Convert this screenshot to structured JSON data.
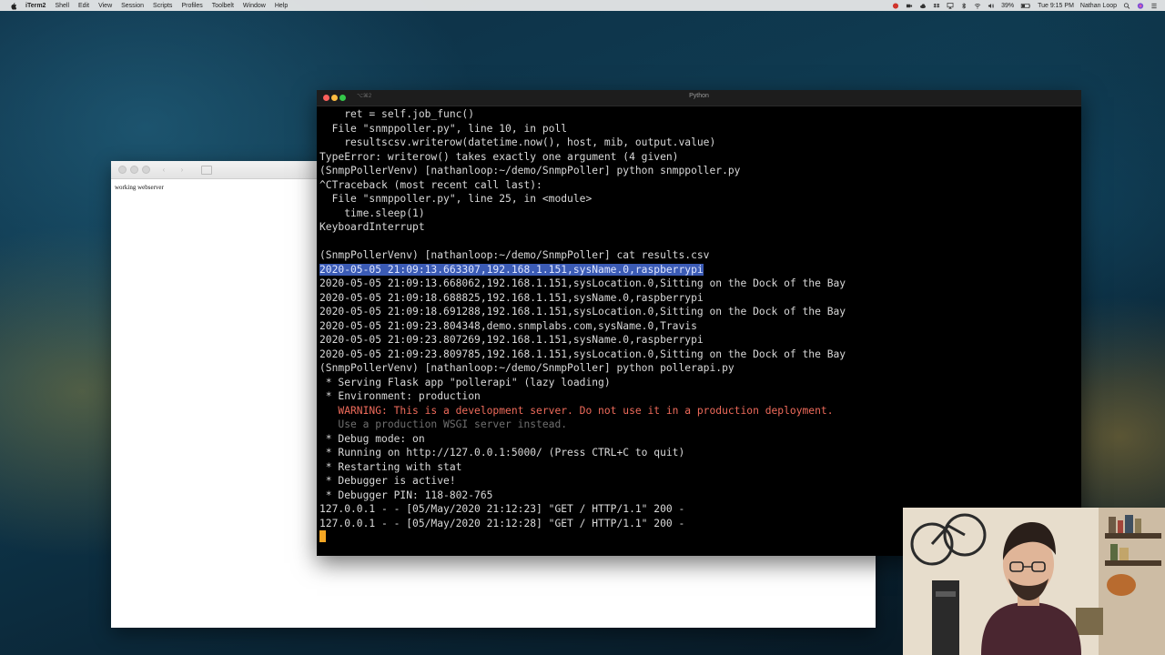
{
  "menubar": {
    "app_name": "iTerm2",
    "items": [
      "Shell",
      "Edit",
      "View",
      "Session",
      "Scripts",
      "Profiles",
      "Toolbelt",
      "Window",
      "Help"
    ],
    "battery": "39%",
    "clock": "Tue 9:15 PM",
    "user": "Nathan Loop"
  },
  "browser": {
    "content_text": "working webserver"
  },
  "terminal": {
    "shortcut": "⌥⌘2",
    "title": "Python",
    "lines": [
      "    ret = self.job_func()",
      "  File \"snmppoller.py\", line 10, in poll",
      "    resultscsv.writerow(datetime.now(), host, mib, output.value)",
      "TypeError: writerow() takes exactly one argument (4 given)",
      "(SnmpPollerVenv) [nathanloop:~/demo/SnmpPoller] python snmppoller.py",
      "^CTraceback (most recent call last):",
      "  File \"snmppoller.py\", line 25, in <module>",
      "    time.sleep(1)",
      "KeyboardInterrupt",
      "",
      "(SnmpPollerVenv) [nathanloop:~/demo/SnmpPoller] cat results.csv",
      "2020-05-05 21:09:13.663307,192.168.1.151,sysName.0,raspberrypi",
      "2020-05-05 21:09:13.668062,192.168.1.151,sysLocation.0,Sitting on the Dock of the Bay",
      "2020-05-05 21:09:18.688825,192.168.1.151,sysName.0,raspberrypi",
      "2020-05-05 21:09:18.691288,192.168.1.151,sysLocation.0,Sitting on the Dock of the Bay",
      "2020-05-05 21:09:23.804348,demo.snmplabs.com,sysName.0,Travis",
      "2020-05-05 21:09:23.807269,192.168.1.151,sysName.0,raspberrypi",
      "2020-05-05 21:09:23.809785,192.168.1.151,sysLocation.0,Sitting on the Dock of the Bay",
      "(SnmpPollerVenv) [nathanloop:~/demo/SnmpPoller] python pollerapi.py",
      " * Serving Flask app \"pollerapi\" (lazy loading)",
      " * Environment: production",
      "   WARNING: This is a development server. Do not use it in a production deployment.",
      "   Use a production WSGI server instead.",
      " * Debug mode: on",
      " * Running on http://127.0.0.1:5000/ (Press CTRL+C to quit)",
      " * Restarting with stat",
      " * Debugger is active!",
      " * Debugger PIN: 118-802-765",
      "127.0.0.1 - - [05/May/2020 21:12:23] \"GET / HTTP/1.1\" 200 -",
      "127.0.0.1 - - [05/May/2020 21:12:28] \"GET / HTTP/1.1\" 200 -"
    ],
    "highlighted_line": 11,
    "warning_line": 21,
    "dim_line": 22
  }
}
